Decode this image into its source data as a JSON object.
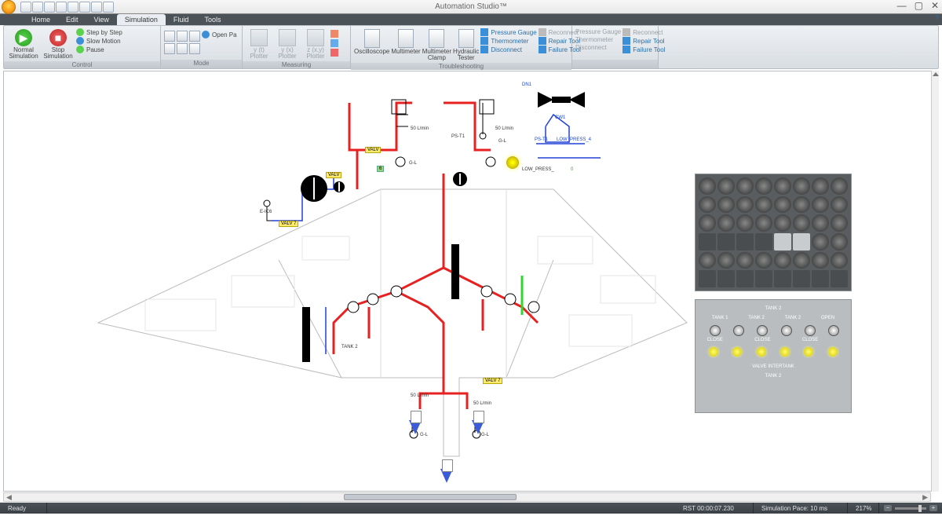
{
  "app": {
    "title": "Automation Studio™"
  },
  "qat_count": 8,
  "win": {
    "min": "—",
    "max": "▢",
    "close": "✕",
    "help": "?"
  },
  "menu": {
    "items": [
      "Home",
      "Edit",
      "View",
      "Simulation",
      "Fluid",
      "Tools"
    ],
    "active_index": 3
  },
  "ribbon": {
    "groups": {
      "control": {
        "label": "Control",
        "normal": "Normal Simulation",
        "stop": "Stop Simulation",
        "steps": [
          "Step by Step",
          "Slow Motion",
          "Pause"
        ]
      },
      "mode": {
        "label": "Mode",
        "open": "Open Pa"
      },
      "measuring": {
        "label": "Measuring",
        "plotters": [
          "y (t) Plotter",
          "y (x) Plotter",
          "z (x,y) Plotter"
        ]
      },
      "troubleshooting": {
        "label": "Troubleshooting",
        "instruments": [
          "Oscilloscope",
          "Multimeter",
          "Multimeter Clamp",
          "Hydraulic Tester"
        ],
        "col1": [
          "Pressure Gauge",
          "Thermometer",
          "Disconnect"
        ],
        "col2": [
          "Reconnect",
          "Repair Tool",
          "Failure Tool"
        ],
        "col3": [
          "Pressure Gauge",
          "Thermometer",
          "Disconnect"
        ],
        "col4": [
          "Reconnect",
          "Repair Tool",
          "Failure Tool"
        ]
      }
    }
  },
  "diagram": {
    "tags": [
      "VALV",
      "VALV",
      "VALV   7",
      "VALV   7",
      "6"
    ],
    "labels": {
      "flow1": "50 L/min",
      "flow2": "50 L/min",
      "flow3": "50 L/min",
      "flow4": "50 L/min",
      "ps": "PS-T1",
      "ec": "E-IC6",
      "gl1": "G-L",
      "gl2": "G-L",
      "gl3": "G-L",
      "gl4": "G-L",
      "dn1": "DN1",
      "cw1": "CW1",
      "psti": "PS-T1",
      "lowpress": "LOW_PRESS_4",
      "lowpress2": "LOW_PRESS_",
      "zero": "0",
      "tank2s": "TANK 2"
    }
  },
  "tankpanel": {
    "title": "TANK 2",
    "groups": [
      "TANK 1",
      "TANK 2",
      "TANK 2"
    ],
    "btns": [
      "CLOSE",
      "CLOSE",
      "CLOSE"
    ],
    "open": "OPEN",
    "footer": "VALVE INTERTANK",
    "footer2": "TANK 2"
  },
  "status": {
    "ready": "Ready",
    "rst": "RST 00:00:07.230",
    "pace": "Simulation Pace: 10 ms",
    "zoom": "217%"
  }
}
